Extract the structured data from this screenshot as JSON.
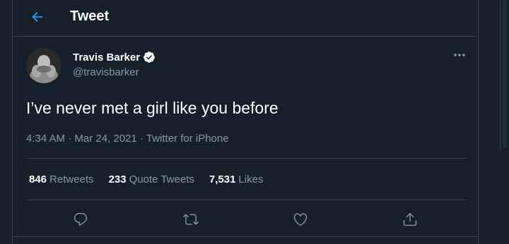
{
  "header": {
    "title": "Tweet",
    "back_icon": "arrow-left-icon"
  },
  "tweet": {
    "author_name": "Travis Barker",
    "author_handle": "@travisbarker",
    "verified": true,
    "text": "I’ve never met a girl like you before",
    "time": "4:34 AM",
    "date": "Mar 24, 2021",
    "source": "Twitter for iPhone",
    "meta_separator": "·"
  },
  "stats": {
    "retweets_count": "846",
    "retweets_label": "Retweets",
    "quotes_count": "233",
    "quotes_label": "Quote Tweets",
    "likes_count": "7,531",
    "likes_label": "Likes"
  },
  "actions": [
    "reply-icon",
    "retweet-icon",
    "like-icon",
    "share-icon"
  ],
  "colors": {
    "background": "#15202b",
    "accent": "#1da1f2",
    "secondary_text": "#8899a6",
    "border": "#38444d"
  }
}
